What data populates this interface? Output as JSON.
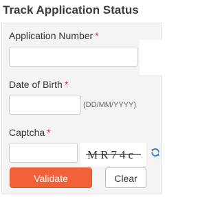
{
  "page_title": "Track Application Status",
  "form": {
    "application_number": {
      "label": "Application Number",
      "required_mark": "*",
      "value": ""
    },
    "date_of_birth": {
      "label": "Date of Birth",
      "required_mark": "*",
      "value": "",
      "hint": "(DD/MM/YYYY)"
    },
    "captcha": {
      "label": "Captcha",
      "required_mark": "*",
      "value": "",
      "image_text": "MR74c"
    }
  },
  "buttons": {
    "validate_label": "Validate",
    "clear_label": "Clear"
  },
  "icons": {
    "refresh": "refresh-icon"
  },
  "colors": {
    "accent": "#f2603a",
    "required": "#d9302a",
    "refresh": "#2a7ad6",
    "panel_bg": "#f4f4f4"
  }
}
